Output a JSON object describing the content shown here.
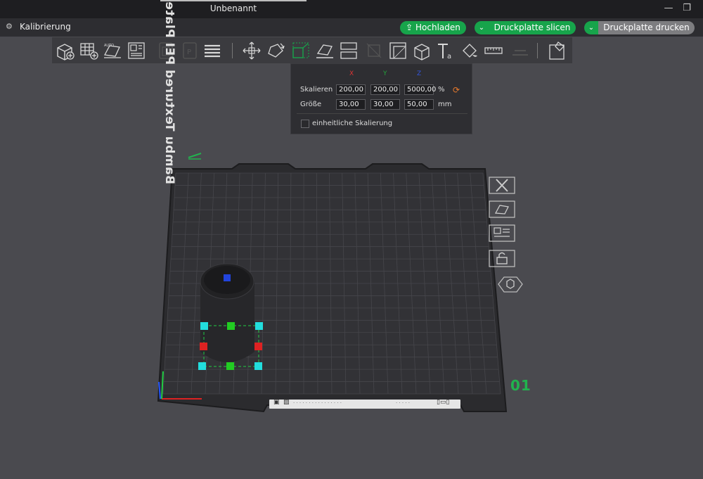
{
  "titlebar": {
    "title": "Unbenannt",
    "minimize_icon": "minimize-icon",
    "restore_icon": "restore-icon"
  },
  "menubar": {
    "project_label": "Kalibrierung",
    "upload_label": "Hochladen",
    "slice_label": "Druckplatte slicen",
    "print_label": "Druckplatte drucken",
    "accent_green": "#17a44b"
  },
  "toolbar": {
    "tools": [
      "add-cube-icon",
      "add-grid-icon",
      "auto-orient-icon",
      "arrange-icon",
      "plate-icon",
      "plate-icon",
      "layers-icon",
      "move-icon",
      "rotate-icon",
      "scale-icon",
      "lay-on-face-icon",
      "split-icon",
      "cut-icon",
      "support-paint-icon",
      "assembly-icon",
      "text-icon",
      "paint-color-icon",
      "measure-icon",
      "emboss-icon",
      "assembly-view-icon"
    ]
  },
  "scale_panel": {
    "axis_x": "X",
    "axis_y": "Y",
    "axis_z": "Z",
    "scale_label": "Skalieren",
    "size_label": "Größe",
    "scale_x": "200,00",
    "scale_y": "200,00",
    "scale_z": "5000,00",
    "scale_unit": "%",
    "size_x": "30,00",
    "size_y": "30,00",
    "size_z": "50,00",
    "size_unit": "mm",
    "uniform_label": "einheitliche Skalierung",
    "uniform_checked": false
  },
  "plate": {
    "name": "Bambu Textured PEI Plate",
    "number": "01",
    "side_tools": [
      "close-icon",
      "auto-orient-icon",
      "arrange-icon",
      "lock-icon",
      "settings-hex-icon"
    ]
  },
  "bottom_bar": {
    "text_left": "· · · · · · · · · ·  · · · · · ·",
    "text_right": "· · · · ·"
  }
}
